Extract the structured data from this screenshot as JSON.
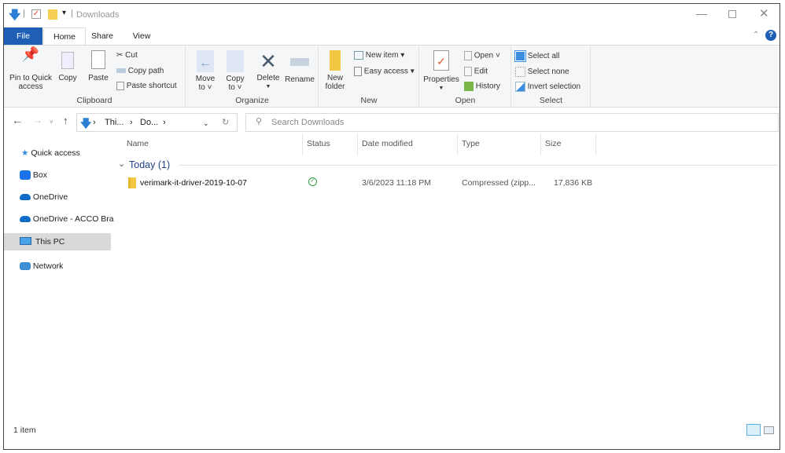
{
  "window": {
    "title": "Downloads"
  },
  "tabs": [
    {
      "label": "File"
    },
    {
      "label": "Home"
    },
    {
      "label": "Share"
    },
    {
      "label": "View"
    }
  ],
  "ribbon": {
    "clipboard": {
      "label": "Clipboard",
      "pin": "Pin to Quick access",
      "pin1": "Pin to Quick",
      "pin2": "access",
      "copy": "Copy",
      "paste": "Paste",
      "cut": "Cut",
      "copy_path": "Copy path",
      "paste_shortcut": "Paste shortcut"
    },
    "organize": {
      "label": "Organize",
      "move1": "Move",
      "move2": "to",
      "copy1": "Copy",
      "copy2": "to",
      "delete": "Delete",
      "rename": "Rename"
    },
    "new": {
      "label": "New",
      "folder1": "New",
      "folder2": "folder",
      "new_item": "New item",
      "easy_access": "Easy access"
    },
    "open": {
      "label": "Open",
      "properties": "Properties",
      "open": "Open",
      "edit": "Edit",
      "history": "History"
    },
    "select": {
      "label": "Select",
      "all": "Select all",
      "none": "Select none",
      "invert": "Invert selection"
    }
  },
  "address": {
    "crumbs": [
      "Thi...",
      "Do..."
    ],
    "search_placeholder": "Search Downloads"
  },
  "sidebar": {
    "items": [
      {
        "label": "Quick access"
      },
      {
        "label": "Box"
      },
      {
        "label": "OneDrive"
      },
      {
        "label": "OneDrive - ACCO Bra"
      },
      {
        "label": "This PC",
        "selected": true
      },
      {
        "label": "Network"
      }
    ]
  },
  "columns": [
    "Name",
    "Status",
    "Date modified",
    "Type",
    "Size"
  ],
  "group": {
    "label": "Today (1)"
  },
  "files": [
    {
      "name": "verimark-it-driver-2019-10-07",
      "status": "synced",
      "date": "3/6/2023 11:18 PM",
      "type": "Compressed (zipp...",
      "size": "17,836 KB"
    }
  ],
  "status": {
    "count": "1 item"
  },
  "colors": {
    "accent": "#1e5fb5",
    "selected": "#d9d9d9",
    "group": "#1e3f8a"
  }
}
